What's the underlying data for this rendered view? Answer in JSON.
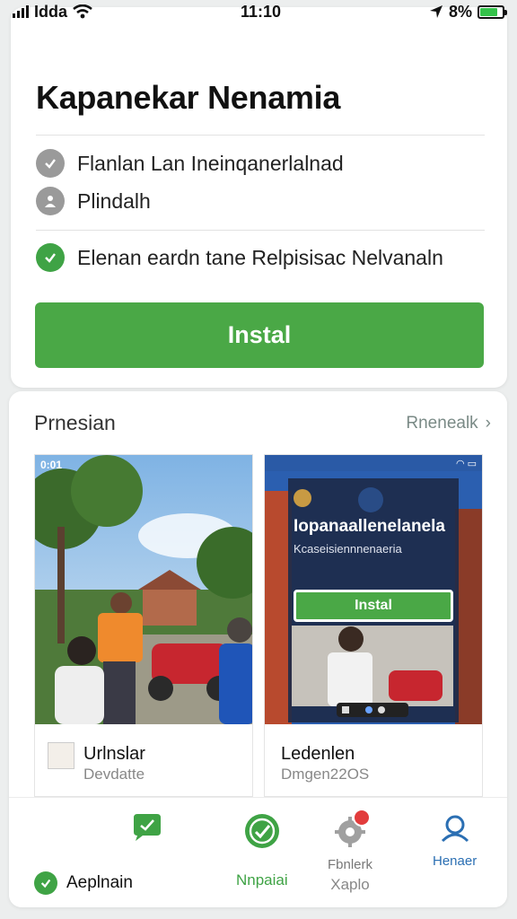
{
  "status_bar": {
    "carrier": "Idda",
    "time": "11:10",
    "battery_percent_text": "8%",
    "battery_level": 0.8
  },
  "app_card": {
    "title": "Kapanekar Nenamia",
    "rows": [
      {
        "icon": "check-circle-icon",
        "text": "Flanlan Lan Ineinqanerlalnad"
      },
      {
        "icon": "person-icon",
        "text": "Plindalh"
      }
    ],
    "note": {
      "icon": "check-circle-icon",
      "text": "Elenan eardn tane Relpisisac Nelvanaln"
    },
    "install_label": "Instal"
  },
  "previews": {
    "title": "Prnesian",
    "see_all_label": "Rnenealk",
    "items": [
      {
        "corner_label": "0:01",
        "title": "Urlnslar",
        "subtitle": "Devdatte"
      },
      {
        "overlay_title": "Iopanaallenelanela",
        "overlay_subtitle": "Kcaseisiennnenaeria",
        "overlay_install_label": "Instal",
        "title": "Ledenlen",
        "subtitle": "Dmgen22OS"
      }
    ]
  },
  "bottom_nav": {
    "left_label": "Aeplnain",
    "items": [
      {
        "icon": "chat-icon",
        "label": ""
      },
      {
        "icon": "check-icon",
        "label": "Nnpaiai"
      },
      {
        "icon": "gear-icon",
        "label": "Fbnlerk",
        "secondary_label": "Xaplo"
      },
      {
        "icon": "profile-icon",
        "label": "Henaer"
      }
    ]
  },
  "colors": {
    "accent_green": "#4aa846",
    "badge_red": "#e23c3c",
    "profile_blue": "#2b6fb3"
  }
}
